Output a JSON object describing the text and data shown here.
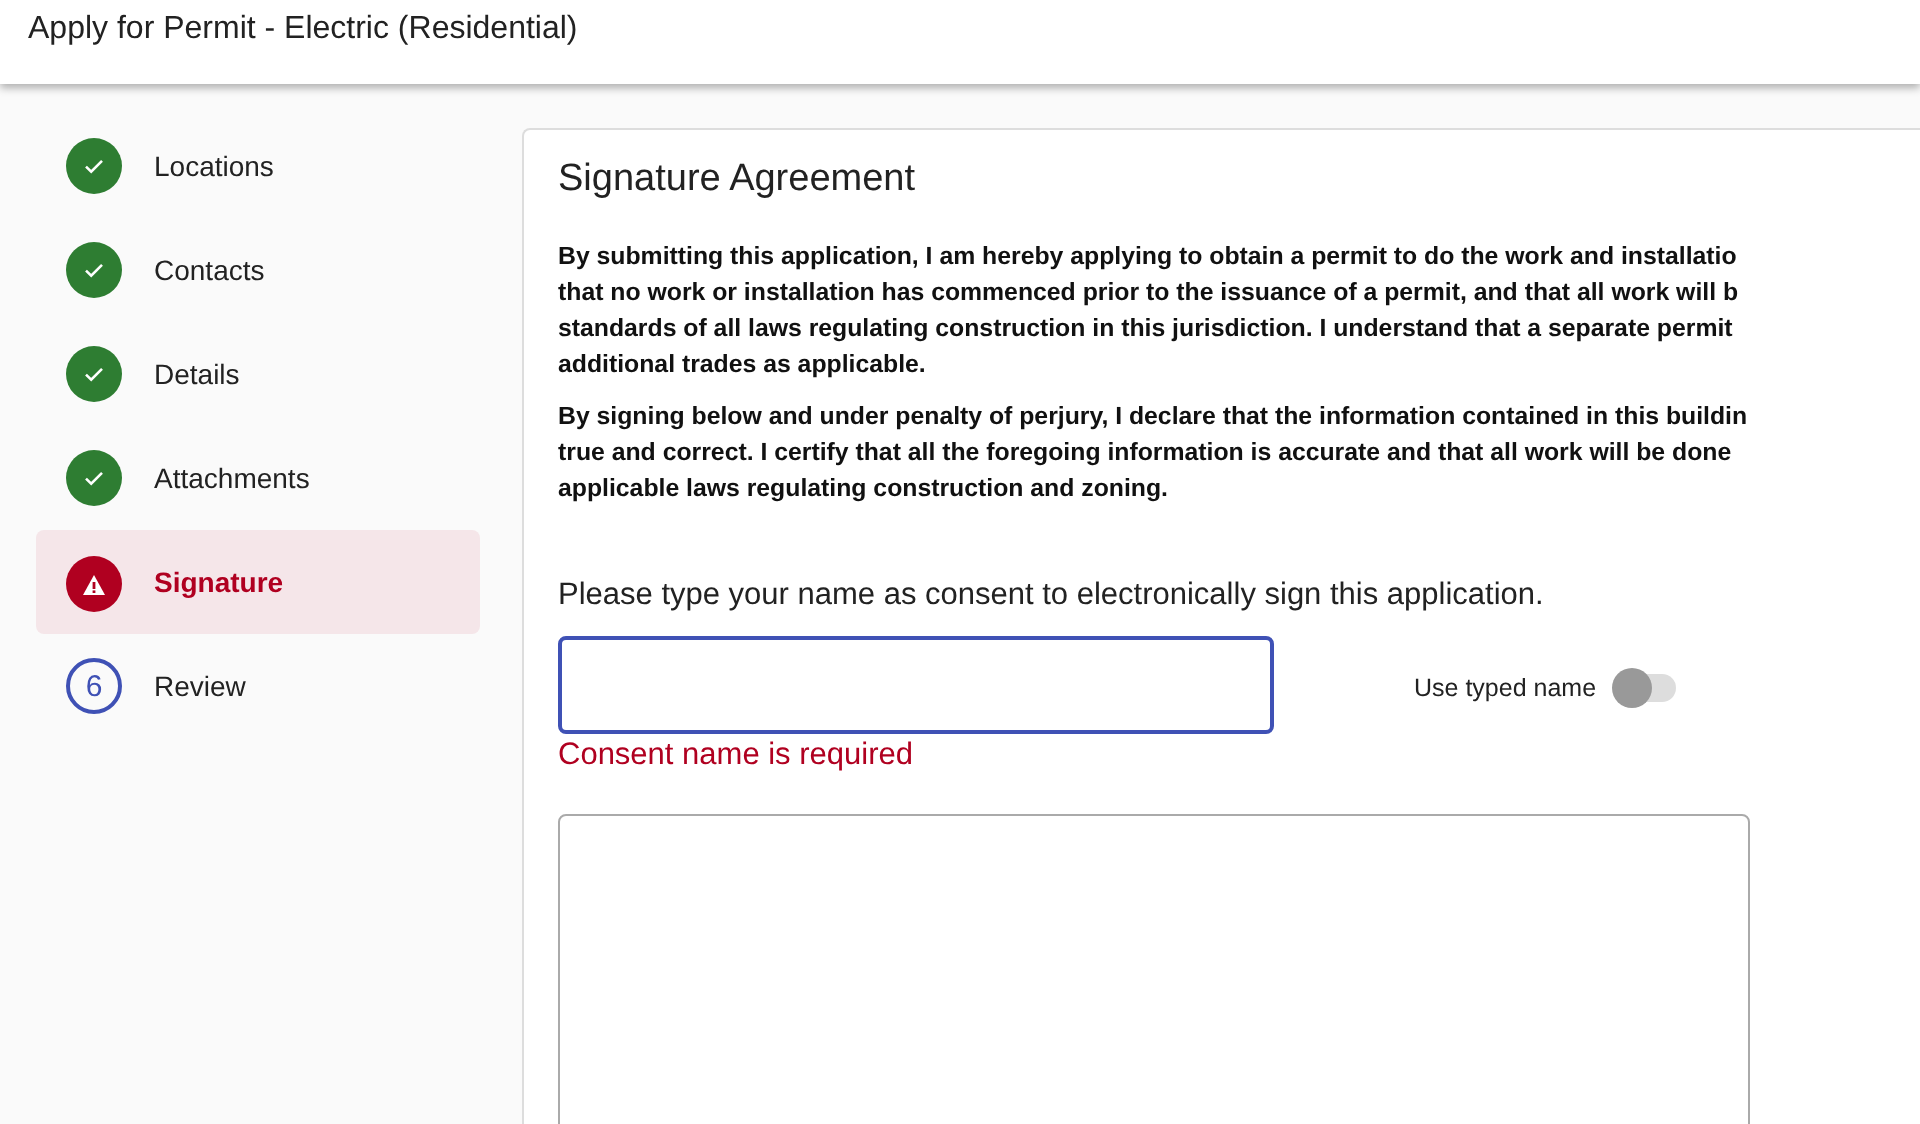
{
  "header": {
    "title": "Apply for Permit - Electric (Residential)"
  },
  "steps": [
    {
      "label": "Locations",
      "kind": "complete",
      "selected": false
    },
    {
      "label": "Contacts",
      "kind": "complete",
      "selected": false
    },
    {
      "label": "Details",
      "kind": "complete",
      "selected": false
    },
    {
      "label": "Attachments",
      "kind": "complete",
      "selected": false
    },
    {
      "label": "Signature",
      "kind": "error",
      "selected": true
    },
    {
      "label": "Review",
      "kind": "pending",
      "number": "6",
      "selected": false
    }
  ],
  "card": {
    "title": "Signature Agreement",
    "paragraphs": [
      [
        "By submitting this application, I am hereby applying to obtain a permit to do the work and installatio",
        "that no work or installation has commenced prior to the issuance of a permit, and that all work will b",
        "standards of all laws regulating construction in this jurisdiction. I understand that a separate permit",
        "additional trades as applicable."
      ],
      [
        "By signing below and under penalty of perjury, I declare that the information contained in this buildin",
        "true and correct. I certify that all the foregoing information is accurate and that all work will be done",
        "applicable laws regulating construction and zoning."
      ]
    ],
    "consent_label": "Please type your name as consent to electronically sign this application.",
    "name_field": {
      "focused": true
    },
    "error": "Consent name is required",
    "toggle": {
      "label": "Use typed name",
      "on": false
    }
  }
}
